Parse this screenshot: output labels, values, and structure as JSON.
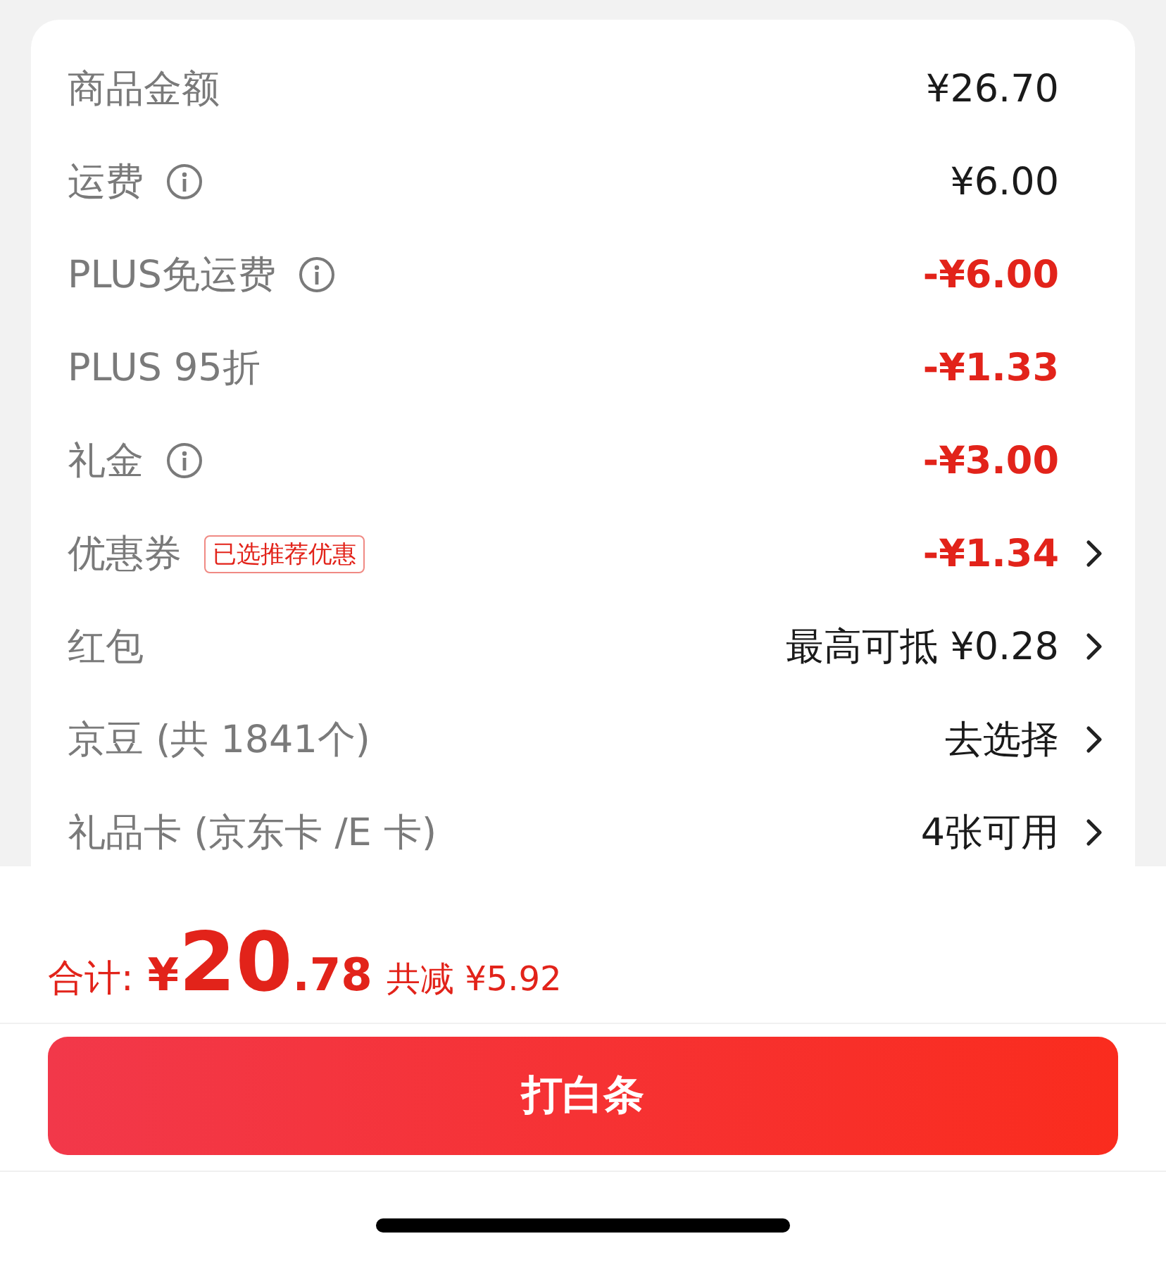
{
  "rows": [
    {
      "label": "商品金额",
      "info": false,
      "value": "¥26.70",
      "discount": false,
      "chevron": false
    },
    {
      "label": "运费",
      "info": true,
      "value": "¥6.00",
      "discount": false,
      "chevron": false
    },
    {
      "label": "PLUS免运费",
      "info": true,
      "value": "-¥6.00",
      "discount": true,
      "chevron": false
    },
    {
      "label": "PLUS 95折",
      "info": false,
      "value": "-¥1.33",
      "discount": true,
      "chevron": false
    },
    {
      "label": "礼金",
      "info": true,
      "value": "-¥3.00",
      "discount": true,
      "chevron": false
    },
    {
      "label": "优惠券",
      "info": false,
      "tag": "已选推荐优惠",
      "value": "-¥1.34",
      "discount": true,
      "chevron": true
    },
    {
      "label": "红包",
      "info": false,
      "value": "最高可抵 ¥0.28",
      "discount": false,
      "chevron": true
    },
    {
      "label": "京豆 (共 1841个)",
      "info": false,
      "value": "去选择",
      "discount": false,
      "chevron": true
    },
    {
      "label": "礼品卡 (京东卡 /E 卡)",
      "info": false,
      "value": "4张可用",
      "discount": false,
      "chevron": true
    }
  ],
  "total": {
    "label": "合计:",
    "currency": "¥",
    "integer": "20",
    "decimal": ".78",
    "savings": "共减 ¥5.92"
  },
  "submit_button": "打白条"
}
